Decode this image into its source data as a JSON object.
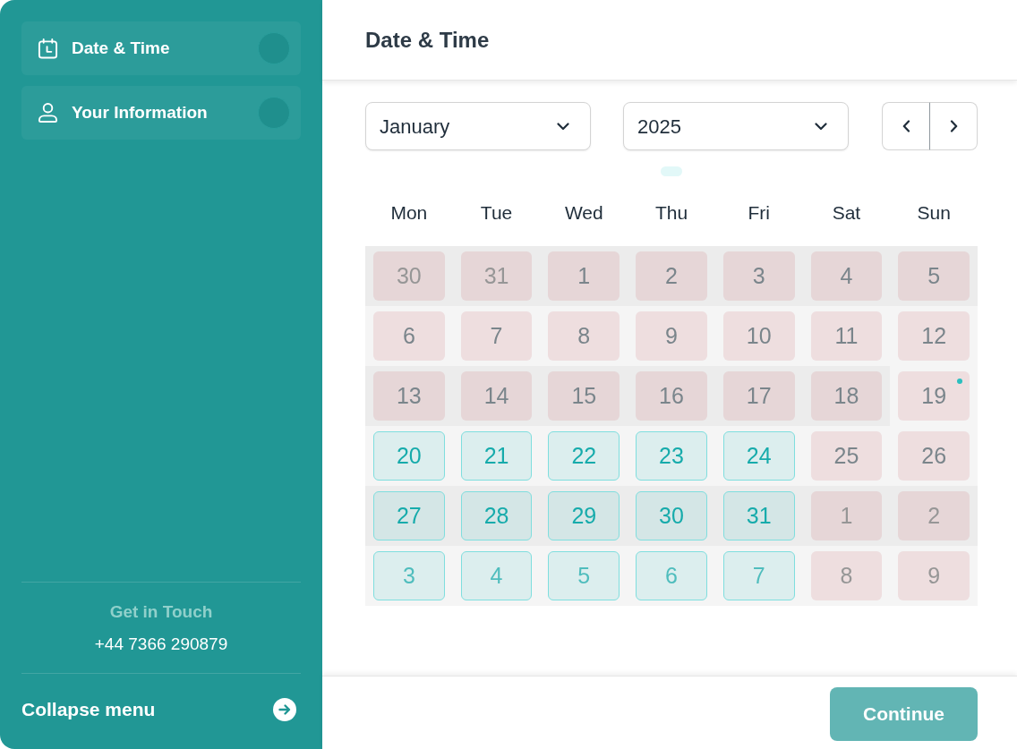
{
  "sidebar": {
    "steps": [
      {
        "label": "Date & Time"
      },
      {
        "label": "Your Information"
      }
    ],
    "contact": {
      "heading": "Get in Touch",
      "phone": "+44 7366 290879"
    },
    "collapse": {
      "label": "Collapse menu"
    }
  },
  "main": {
    "title": "Date & Time",
    "month_select": {
      "value": "January"
    },
    "year_select": {
      "value": "2025"
    },
    "calendar": {
      "weekdays": [
        "Mon",
        "Tue",
        "Wed",
        "Thu",
        "Fri",
        "Sat",
        "Sun"
      ],
      "weeks": [
        [
          {
            "day": "30",
            "kind": "unavailable",
            "outside_month": true,
            "today": false
          },
          {
            "day": "31",
            "kind": "unavailable",
            "outside_month": true,
            "today": false
          },
          {
            "day": "1",
            "kind": "unavailable",
            "outside_month": false,
            "today": false
          },
          {
            "day": "2",
            "kind": "unavailable",
            "outside_month": false,
            "today": false
          },
          {
            "day": "3",
            "kind": "unavailable",
            "outside_month": false,
            "today": false
          },
          {
            "day": "4",
            "kind": "unavailable",
            "outside_month": false,
            "today": false
          },
          {
            "day": "5",
            "kind": "unavailable",
            "outside_month": false,
            "today": false
          }
        ],
        [
          {
            "day": "6",
            "kind": "unavailable",
            "outside_month": false,
            "today": false
          },
          {
            "day": "7",
            "kind": "unavailable",
            "outside_month": false,
            "today": false
          },
          {
            "day": "8",
            "kind": "unavailable",
            "outside_month": false,
            "today": false
          },
          {
            "day": "9",
            "kind": "unavailable",
            "outside_month": false,
            "today": false
          },
          {
            "day": "10",
            "kind": "unavailable",
            "outside_month": false,
            "today": false
          },
          {
            "day": "11",
            "kind": "unavailable",
            "outside_month": false,
            "today": false
          },
          {
            "day": "12",
            "kind": "unavailable",
            "outside_month": false,
            "today": false
          }
        ],
        [
          {
            "day": "13",
            "kind": "unavailable",
            "outside_month": false,
            "today": false
          },
          {
            "day": "14",
            "kind": "unavailable",
            "outside_month": false,
            "today": false
          },
          {
            "day": "15",
            "kind": "unavailable",
            "outside_month": false,
            "today": false
          },
          {
            "day": "16",
            "kind": "unavailable",
            "outside_month": false,
            "today": false
          },
          {
            "day": "17",
            "kind": "unavailable",
            "outside_month": false,
            "today": false
          },
          {
            "day": "18",
            "kind": "unavailable",
            "outside_month": false,
            "today": false
          },
          {
            "day": "19",
            "kind": "unavailable",
            "outside_month": false,
            "today": true
          }
        ],
        [
          {
            "day": "20",
            "kind": "available",
            "outside_month": false,
            "today": false
          },
          {
            "day": "21",
            "kind": "available",
            "outside_month": false,
            "today": false
          },
          {
            "day": "22",
            "kind": "available",
            "outside_month": false,
            "today": false
          },
          {
            "day": "23",
            "kind": "available",
            "outside_month": false,
            "today": false
          },
          {
            "day": "24",
            "kind": "available",
            "outside_month": false,
            "today": false
          },
          {
            "day": "25",
            "kind": "unavailable",
            "outside_month": false,
            "today": false
          },
          {
            "day": "26",
            "kind": "unavailable",
            "outside_month": false,
            "today": false
          }
        ],
        [
          {
            "day": "27",
            "kind": "available",
            "outside_month": false,
            "today": false
          },
          {
            "day": "28",
            "kind": "available",
            "outside_month": false,
            "today": false
          },
          {
            "day": "29",
            "kind": "available",
            "outside_month": false,
            "today": false
          },
          {
            "day": "30",
            "kind": "available",
            "outside_month": false,
            "today": false
          },
          {
            "day": "31",
            "kind": "available",
            "outside_month": false,
            "today": false
          },
          {
            "day": "1",
            "kind": "unavailable",
            "outside_month": true,
            "today": false
          },
          {
            "day": "2",
            "kind": "unavailable",
            "outside_month": true,
            "today": false
          }
        ],
        [
          {
            "day": "3",
            "kind": "available",
            "outside_month": true,
            "today": false
          },
          {
            "day": "4",
            "kind": "available",
            "outside_month": true,
            "today": false
          },
          {
            "day": "5",
            "kind": "available",
            "outside_month": true,
            "today": false
          },
          {
            "day": "6",
            "kind": "available",
            "outside_month": true,
            "today": false
          },
          {
            "day": "7",
            "kind": "available",
            "outside_month": true,
            "today": false
          },
          {
            "day": "8",
            "kind": "unavailable",
            "outside_month": true,
            "today": false
          },
          {
            "day": "9",
            "kind": "unavailable",
            "outside_month": true,
            "today": false
          }
        ]
      ]
    }
  },
  "footer": {
    "continue_button": {
      "label": "Continue",
      "disabled": true
    }
  }
}
